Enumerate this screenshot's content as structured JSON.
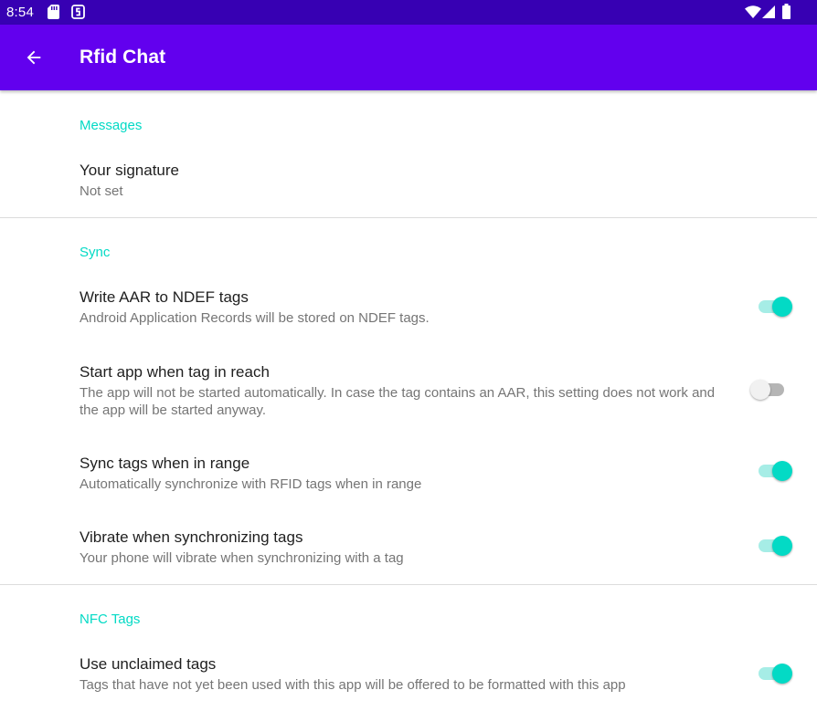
{
  "status_bar": {
    "time": "8:54",
    "icons_left": [
      "sd-card-icon",
      "notification-icon"
    ],
    "icons_right": [
      "wifi-icon",
      "cell-signal-icon",
      "battery-icon"
    ]
  },
  "app_bar": {
    "title": "Rfid Chat",
    "back_icon": "arrow-back-icon"
  },
  "colors": {
    "status_bar": "#3700b3",
    "app_bar": "#6200ee",
    "accent": "#03dac5",
    "divider": "#dcdcdc",
    "title_text": "#1f1f1f",
    "summary_text": "#757575"
  },
  "sections": [
    {
      "category": "Messages",
      "items": [
        {
          "title": "Your signature",
          "summary": "Not set"
        }
      ]
    },
    {
      "category": "Sync",
      "items": [
        {
          "title": "Write AAR to NDEF tags",
          "summary": "Android Application Records will be stored on NDEF tags.",
          "enabled": true
        },
        {
          "title": "Start app when tag in reach",
          "summary": "The app will not be started automatically. In case the tag contains an AAR, this setting does not work and the app will be started anyway.",
          "enabled": false
        },
        {
          "title": "Sync tags when in range",
          "summary": "Automatically synchronize with RFID tags when in range",
          "enabled": true
        },
        {
          "title": "Vibrate when synchronizing tags",
          "summary": "Your phone will vibrate when synchronizing with a tag",
          "enabled": true
        }
      ]
    },
    {
      "category": "NFC Tags",
      "items": [
        {
          "title": "Use unclaimed tags",
          "summary": "Tags that have not yet been used with this app will be offered to be formatted with this app",
          "enabled": true
        }
      ]
    }
  ]
}
